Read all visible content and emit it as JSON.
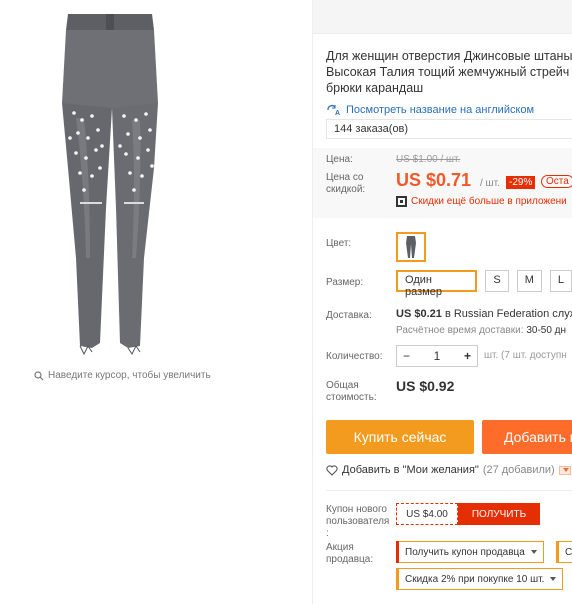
{
  "product": {
    "title_lines": [
      "Для женщин отверстия Джинсовые штаны",
      "Высокая Талия тощий жемчужный стрейч",
      "брюки карандаш"
    ],
    "translate_link": "Посмотреть название на английском",
    "orders": "144 заказа(ов)"
  },
  "gallery": {
    "zoom_hint": "Наведите курсор, чтобы увеличить"
  },
  "price": {
    "price_label": "Цена:",
    "old_price": "US $1.00 / шт.",
    "discount_label_line1": "Цена со",
    "discount_label_line2": "скидкой:",
    "current_price": "US $0.71",
    "unit": "/ шт.",
    "discount_badge": "-29%",
    "remaining_badge": "Оста",
    "app_discount": "Скидки ещё больше в приложени"
  },
  "options": {
    "color_label": "Цвет:",
    "size_label": "Размер:",
    "sizes": [
      "Один размер",
      "S",
      "M",
      "L"
    ]
  },
  "shipping": {
    "label": "Доставка:",
    "price": "US $0.21",
    "service": "в Russian Federation служб",
    "time_label": "Расчётное время доставки:",
    "time_value": "30-50 дн"
  },
  "quantity": {
    "label": "Количество:",
    "value": "1",
    "minus": "−",
    "plus": "+",
    "note": "шт. (7 шт. доступн"
  },
  "total": {
    "label_line1": "Общая",
    "label_line2": "стоимость:",
    "value": "US $0.92"
  },
  "actions": {
    "buy_now": "Купить сейчас",
    "add_to_cart": "Добавить в",
    "wishlist": "Добавить в \"Мои желания\"",
    "wishlist_count": "(27 добавили)"
  },
  "coupons": {
    "new_user_label_line1": "Купон нового",
    "new_user_label_line2": "пользователя",
    "new_user_label_line3": ":",
    "new_user_value": "US $4.00",
    "new_user_button": "ПОЛУЧИТЬ",
    "seller_promo_label_line1": "Акция",
    "seller_promo_label_line2": "продавца:",
    "seller_coupon": "Получить купон продавца",
    "seller_coupon_2": "С",
    "bulk_discount": "Скидка 2% при покупке 10 шт."
  },
  "colors": {
    "accent_orange": "#f29b1e",
    "price_red": "#f0592a",
    "badge_red": "#e62e04",
    "cart_orange": "#fe6c2b",
    "link_blue": "#2a6fb6"
  }
}
